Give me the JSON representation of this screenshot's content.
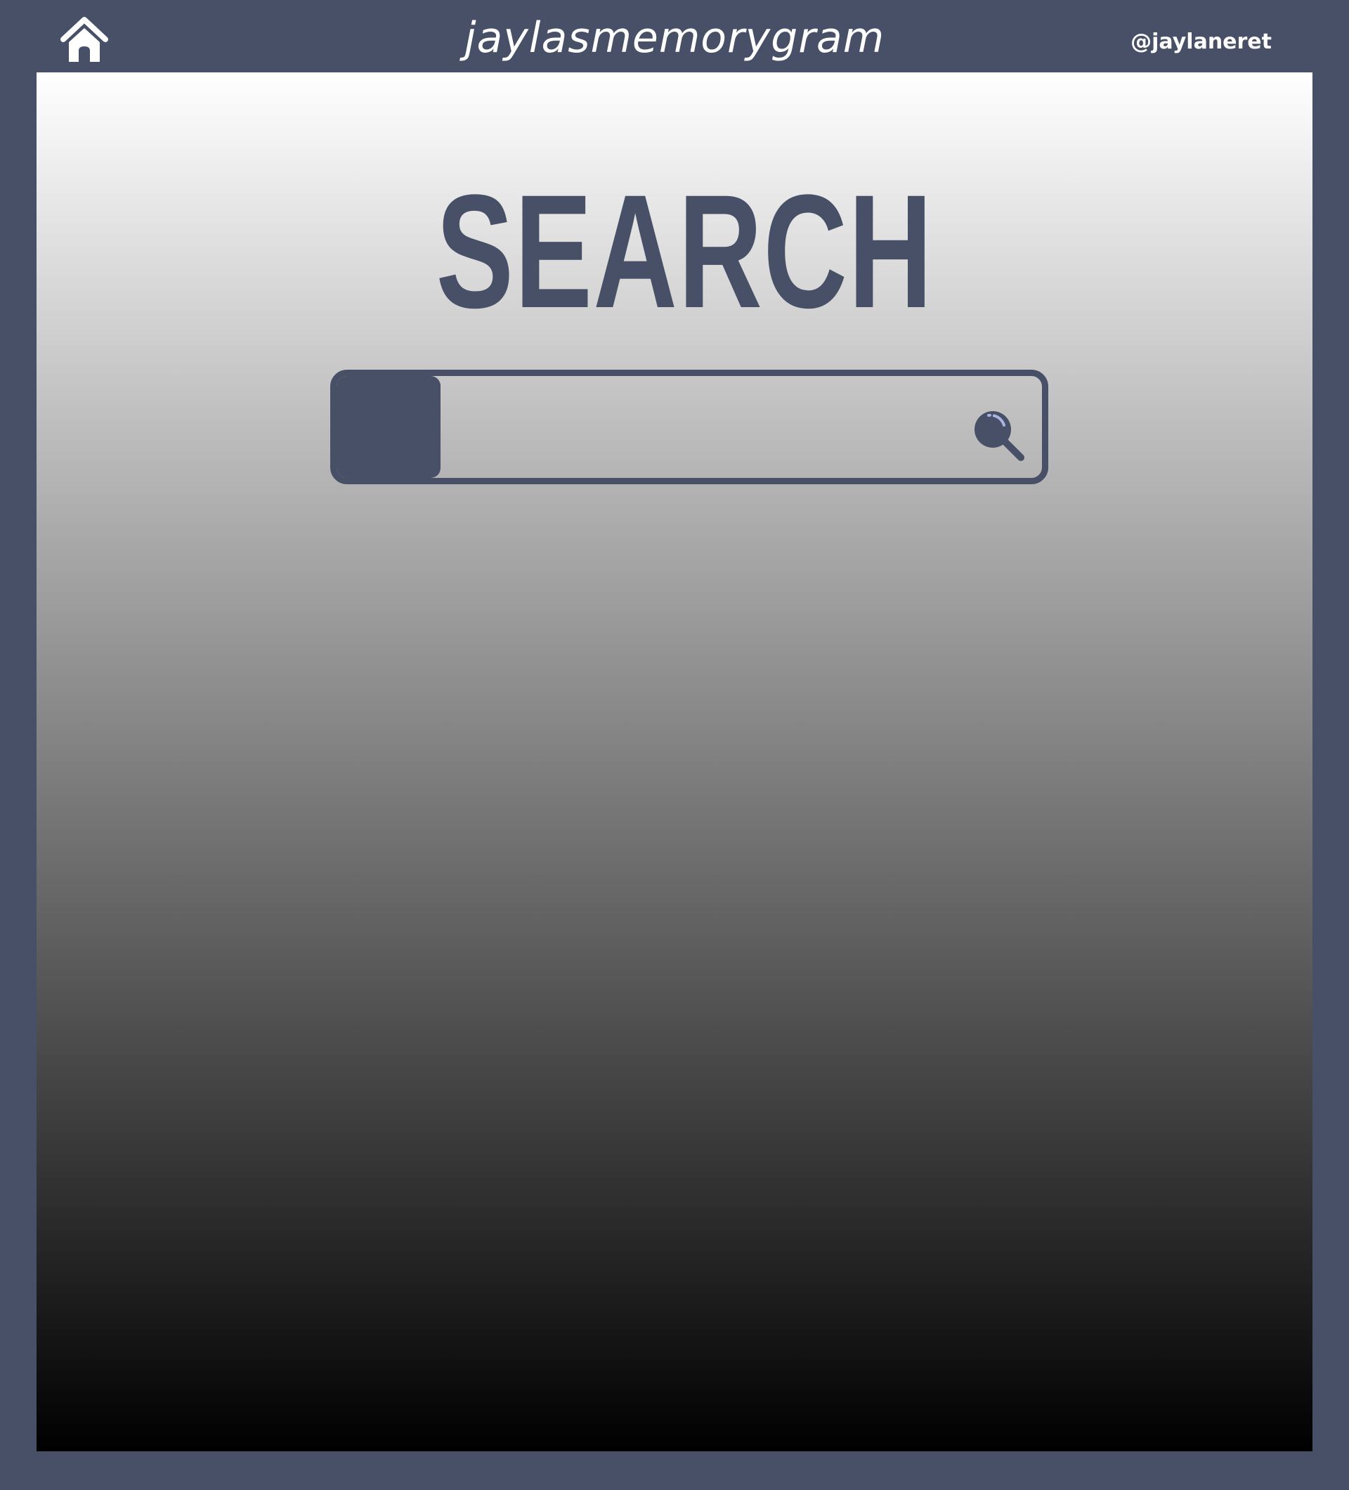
{
  "header": {
    "home_icon": "home-icon",
    "title": "jaylasmemorygram",
    "handle": "@jaylaneret"
  },
  "main": {
    "heading": "SEARCH",
    "search": {
      "value": "",
      "placeholder": "",
      "icon": "magnifier-icon"
    }
  },
  "colors": {
    "frame": "#475066",
    "accent_text": "#475066",
    "header_text": "#ffffff",
    "gradient_top": "#ffffff",
    "gradient_bottom": "#000000",
    "icon_highlight": "#a9b4e0"
  }
}
